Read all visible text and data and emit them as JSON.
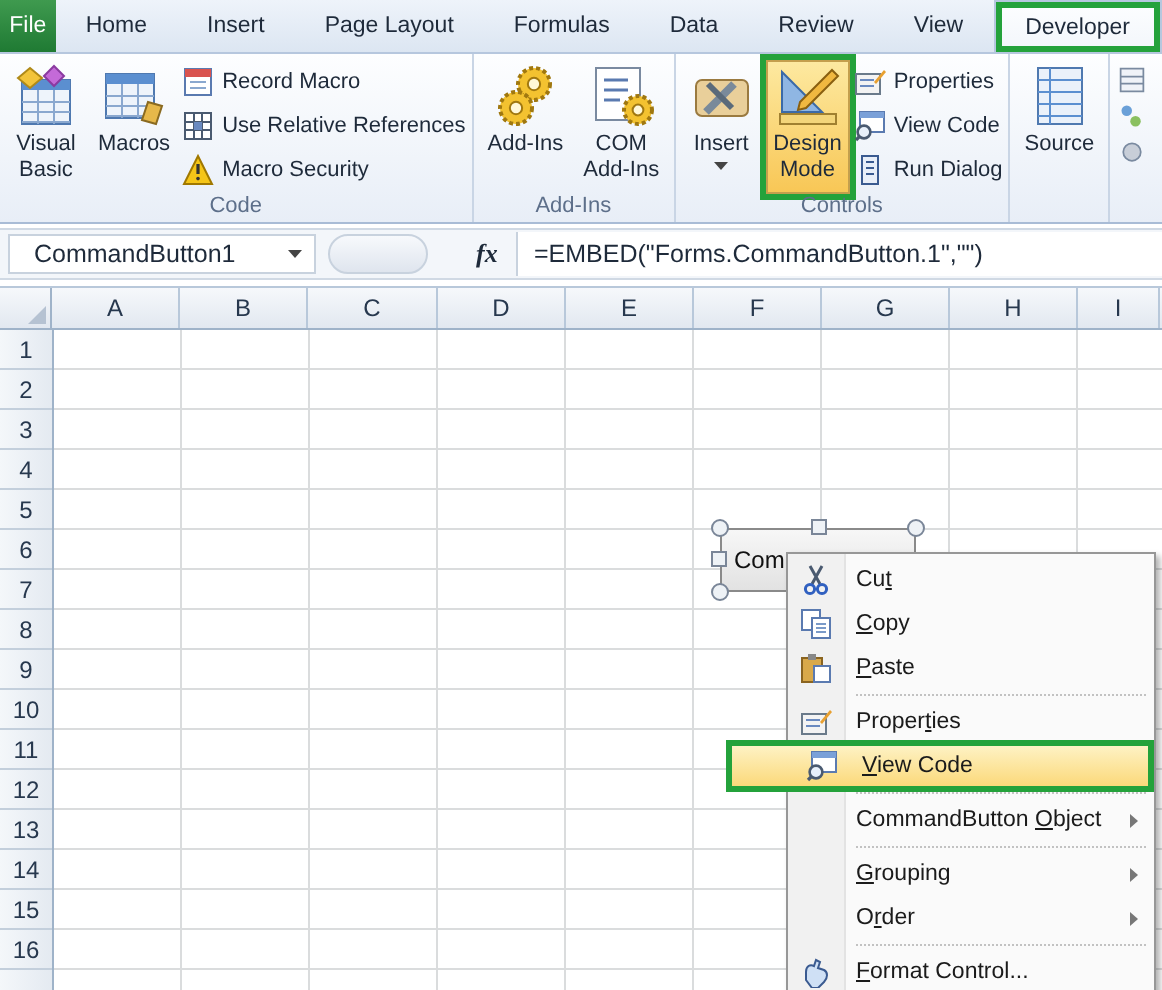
{
  "tabs": [
    {
      "label": "File",
      "kind": "file",
      "selected": false,
      "highlighted": false
    },
    {
      "label": "Home",
      "kind": "tab",
      "selected": false,
      "highlighted": false
    },
    {
      "label": "Insert",
      "kind": "tab",
      "selected": false,
      "highlighted": false
    },
    {
      "label": "Page Layout",
      "kind": "tab",
      "selected": false,
      "highlighted": false
    },
    {
      "label": "Formulas",
      "kind": "tab",
      "selected": false,
      "highlighted": false
    },
    {
      "label": "Data",
      "kind": "tab",
      "selected": false,
      "highlighted": false
    },
    {
      "label": "Review",
      "kind": "tab",
      "selected": false,
      "highlighted": false
    },
    {
      "label": "View",
      "kind": "tab",
      "selected": false,
      "highlighted": false
    },
    {
      "label": "Developer",
      "kind": "tab",
      "selected": true,
      "highlighted": true
    }
  ],
  "ribbon": {
    "groups": [
      {
        "label": "Code",
        "items": [
          {
            "kind": "large",
            "lines": [
              "Visual",
              "Basic"
            ]
          },
          {
            "kind": "large",
            "lines": [
              "Macros"
            ]
          },
          {
            "kind": "small",
            "label": "Record Macro"
          },
          {
            "kind": "small",
            "label": "Use Relative References"
          },
          {
            "kind": "small",
            "label": "Macro Security"
          }
        ]
      },
      {
        "label": "Add-Ins",
        "items": [
          {
            "kind": "large",
            "lines": [
              "Add-Ins"
            ]
          },
          {
            "kind": "large",
            "lines": [
              "COM",
              "Add-Ins"
            ]
          }
        ]
      },
      {
        "label": "Controls",
        "items": [
          {
            "kind": "large",
            "lines": [
              "Insert"
            ],
            "dropdown": true
          },
          {
            "kind": "large",
            "lines": [
              "Design",
              "Mode"
            ],
            "on": true,
            "highlighted": true
          },
          {
            "kind": "small",
            "label": "Properties"
          },
          {
            "kind": "small",
            "label": "View Code"
          },
          {
            "kind": "small",
            "label": "Run Dialog"
          }
        ]
      },
      {
        "items": [
          {
            "kind": "large",
            "lines": [
              "Source"
            ]
          }
        ]
      }
    ]
  },
  "formula_bar": {
    "name_box": "CommandButton1",
    "function_label": "fx",
    "formula": "=EMBED(\"Forms.CommandButton.1\",\"\")"
  },
  "sheet": {
    "columns": [
      "A",
      "B",
      "C",
      "D",
      "E",
      "F",
      "G",
      "H",
      "I"
    ],
    "rows": [
      "1",
      "2",
      "3",
      "4",
      "5",
      "6",
      "7",
      "8",
      "9",
      "10",
      "11",
      "12",
      "13",
      "14",
      "15",
      "16"
    ]
  },
  "command_button": {
    "label": "Com",
    "selected": true
  },
  "context_menu": {
    "items": [
      {
        "kind": "item",
        "pre": "Cu",
        "key": "t",
        "submenu": false,
        "highlighted": false
      },
      {
        "kind": "item",
        "key": "C",
        "post": "opy",
        "submenu": false,
        "highlighted": false
      },
      {
        "kind": "item",
        "key": "P",
        "post": "aste",
        "submenu": false,
        "highlighted": false
      },
      {
        "kind": "separator"
      },
      {
        "kind": "item",
        "pre": "Proper",
        "key": "t",
        "post": "ies",
        "submenu": false,
        "highlighted": false
      },
      {
        "kind": "item",
        "key": "V",
        "post": "iew Code",
        "submenu": false,
        "highlighted": true
      },
      {
        "kind": "separator"
      },
      {
        "kind": "item",
        "pre": "CommandButton ",
        "key": "O",
        "post": "bject",
        "submenu": true,
        "highlighted": false
      },
      {
        "kind": "separator"
      },
      {
        "kind": "item",
        "key": "G",
        "post": "rouping",
        "submenu": true,
        "highlighted": false
      },
      {
        "kind": "item",
        "pre": "O",
        "key": "r",
        "post": "der",
        "submenu": true,
        "highlighted": false
      },
      {
        "kind": "separator"
      },
      {
        "kind": "item",
        "key": "F",
        "post": "ormat Control...",
        "submenu": false,
        "highlighted": false
      }
    ]
  }
}
